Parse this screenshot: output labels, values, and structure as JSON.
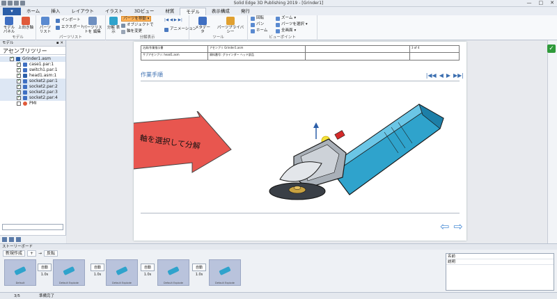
{
  "window": {
    "title": "Solid Edge 3D Publishing 2019 - [Grinder1]",
    "controls": [
      "—",
      "□",
      "✕"
    ]
  },
  "app_button_label": "",
  "tabs": [
    "ホーム",
    "挿入",
    "レイアウト",
    "イラスト",
    "3Dビュー",
    "材質",
    "モデル",
    "表示構成",
    "発行"
  ],
  "active_tab": "モデル",
  "ribbon": {
    "groups": [
      {
        "label": "モデル",
        "buttons": [
          "モデル パネル",
          "上向き軸"
        ]
      },
      {
        "label": "パーツリスト",
        "buttons": [
          "パーツ リスト",
          "インポート",
          "エクスポート",
          "パーツリストを 編集"
        ]
      },
      {
        "label": "分解表示",
        "buttons": [
          "分解 表示",
          "パーツを移動",
          "オブジェクトで",
          "軸を変更",
          "アニメーション"
        ]
      },
      {
        "label": "ツール",
        "buttons": [
          "メタデータ",
          "パーツプライバシー"
        ]
      },
      {
        "label": "ビューポイント",
        "buttons": [
          "回転",
          "パン",
          "ホーム",
          "ズーム",
          "パーツを選択",
          "全画面"
        ]
      }
    ]
  },
  "left_panel": {
    "header": "モデル",
    "title": "アセンブリツリー",
    "tree": [
      {
        "label": "Grinder1.asm",
        "checked": true,
        "level": 0
      },
      {
        "label": "case1.par:1",
        "checked": true,
        "level": 1
      },
      {
        "label": "switch1.par:1",
        "checked": true,
        "level": 1
      },
      {
        "label": "head1.asm:1",
        "checked": true,
        "level": 1
      },
      {
        "label": "socket2.par:1",
        "checked": true,
        "level": 1
      },
      {
        "label": "socket2.par:2",
        "checked": true,
        "level": 1
      },
      {
        "label": "socket2.par:3",
        "checked": true,
        "level": 1
      },
      {
        "label": "socket2.par:4",
        "checked": true,
        "level": 1
      },
      {
        "label": "PMI",
        "checked": false,
        "level": 1
      }
    ]
  },
  "page": {
    "header_rows": [
      [
        "冶具/作業指示書",
        "アセンブリ Grinder1.asm",
        "",
        "3 of 4"
      ],
      [
        "サブアセンブリ: head1.asm",
        "資料番号: グラインダー ヘッド部品",
        "",
        ""
      ]
    ],
    "section_title": "作業手順",
    "callout_text": "軸を選択して分解"
  },
  "storyboard": {
    "header": "ストーリーボード",
    "tools": [
      "新規作成",
      "+",
      "反転"
    ],
    "frames": [
      {
        "caption": "Default",
        "transition": "自動",
        "duration": "1.0s"
      },
      {
        "caption": "Default Explode",
        "transition": "自動",
        "duration": "1.0s"
      },
      {
        "caption": "Default Explode",
        "transition": "自動",
        "duration": "1.0s"
      },
      {
        "caption": "Default Explode",
        "transition": "自動",
        "duration": "1.0s"
      },
      {
        "caption": "Default Explode",
        "transition": "",
        "duration": ""
      }
    ]
  },
  "properties": {
    "rows": [
      "名前",
      "説明"
    ]
  },
  "statusbar": {
    "page": "3/5",
    "status": "準備完了"
  }
}
